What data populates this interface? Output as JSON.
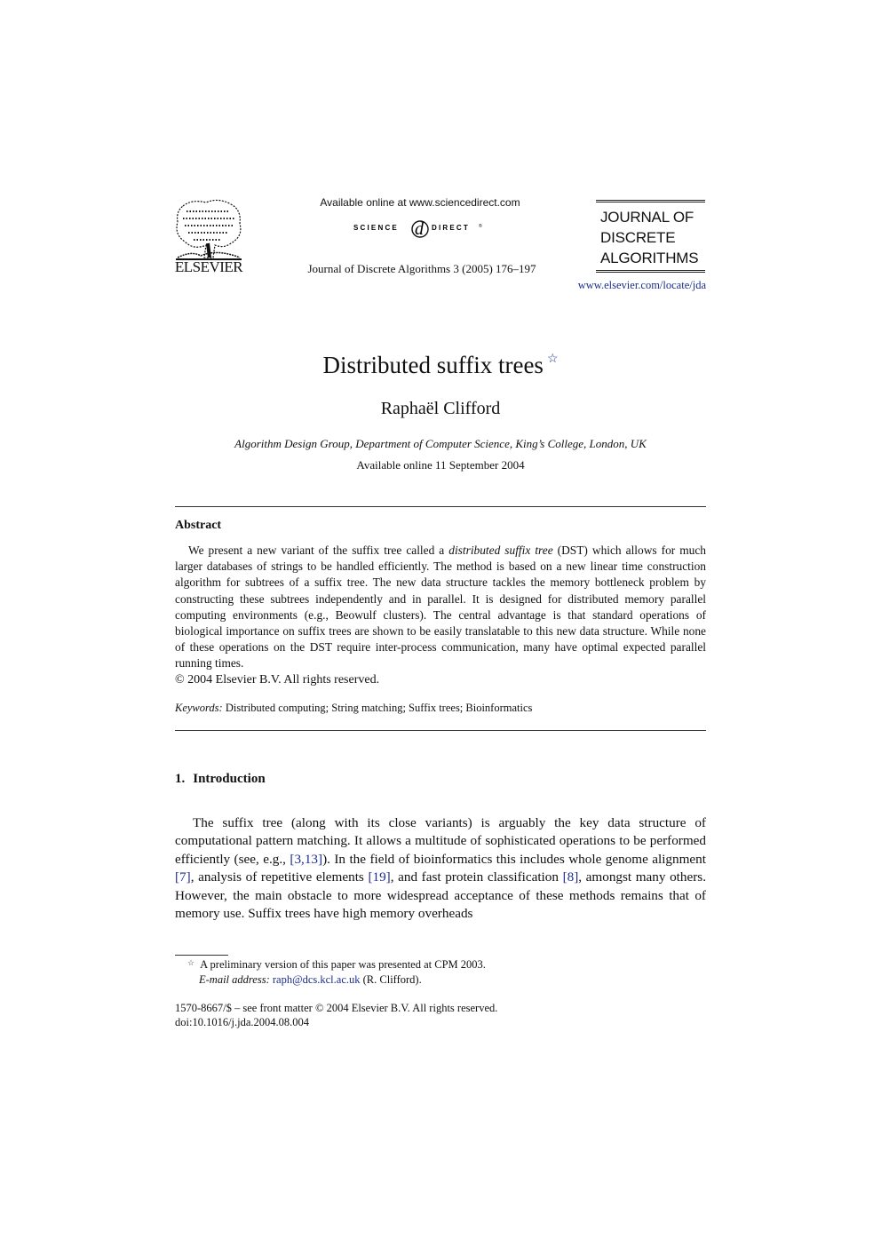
{
  "header": {
    "publisher_logo_text": "ELSEVIER",
    "available_online": "Available online at www.sciencedirect.com",
    "sciencedirect_logo": {
      "left": "SCIENCE",
      "mark": "d",
      "right": "DIRECT",
      "reg": "®"
    },
    "journal_citation": "Journal of Discrete Algorithms 3 (2005) 176–197",
    "journal_logo_lines": [
      "JOURNAL OF",
      "DISCRETE",
      "ALGORITHMS"
    ],
    "journal_url": "www.elsevier.com/locate/jda"
  },
  "article": {
    "title": "Distributed suffix trees",
    "title_note_mark": "☆",
    "author": "Raphaël Clifford",
    "affiliation": "Algorithm Design Group, Department of Computer Science, King’s College, London, UK",
    "available_date": "Available online 11 September 2004"
  },
  "abstract": {
    "heading": "Abstract",
    "text_before_italic": "We present a new variant of the suffix tree called a ",
    "italic_term": "distributed suffix tree",
    "text_after_italic": " (DST) which allows for much larger databases of strings to be handled efficiently. The method is based on a new linear time construction algorithm for subtrees of a suffix tree. The new data structure tackles the memory bottleneck problem by constructing these subtrees independently and in parallel. It is designed for distributed memory parallel computing environments (e.g., Beowulf clusters). The central advantage is that standard operations of biological importance on suffix trees are shown to be easily translatable to this new data structure. While none of these operations on the DST require inter-process communication, many have optimal expected parallel running times.",
    "copyright": "© 2004 Elsevier B.V. All rights reserved.",
    "keywords_label": "Keywords:",
    "keywords": "Distributed computing; String matching; Suffix trees; Bioinformatics"
  },
  "introduction": {
    "number": "1.",
    "heading": "Introduction",
    "t1": "The suffix tree (along with its close variants) is arguably the key data structure of computational pattern matching. It allows a multitude of sophisticated operations to be performed efficiently (see, e.g., ",
    "c1": "[3,13]",
    "t2": "). In the field of bioinformatics this includes whole genome alignment ",
    "c2": "[7]",
    "t3": ", analysis of repetitive elements ",
    "c3": "[19]",
    "t4": ", and fast protein classification ",
    "c4": "[8]",
    "t5": ", amongst many others. However, the main obstacle to more widespread acceptance of these methods remains that of memory use. Suffix trees have high memory overheads"
  },
  "footnotes": {
    "note_mark": "☆",
    "note_text": "A preliminary version of this paper was presented at CPM 2003.",
    "email_label": "E-mail address:",
    "email": "raph@dcs.kcl.ac.uk",
    "email_suffix": " (R. Clifford).",
    "front_matter": "1570-8667/$ – see front matter  © 2004 Elsevier B.V. All rights reserved.",
    "doi": "doi:10.1016/j.jda.2004.08.004"
  }
}
